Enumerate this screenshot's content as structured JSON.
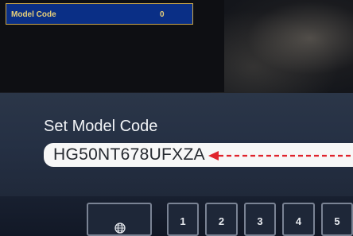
{
  "service_menu": {
    "row_label": "Model Code",
    "row_value": "0"
  },
  "dialog": {
    "title": "Set Model Code",
    "code_value": "HG50NT678UFXZA"
  },
  "keyboard": {
    "language_icon": "globe-icon",
    "keys": [
      "1",
      "2",
      "3",
      "4",
      "5"
    ]
  },
  "colors": {
    "menu_bg": "#0a2f86",
    "menu_text": "#e8d07a",
    "dialog_bg": "#253044",
    "annotation_arrow": "#e0242c"
  }
}
